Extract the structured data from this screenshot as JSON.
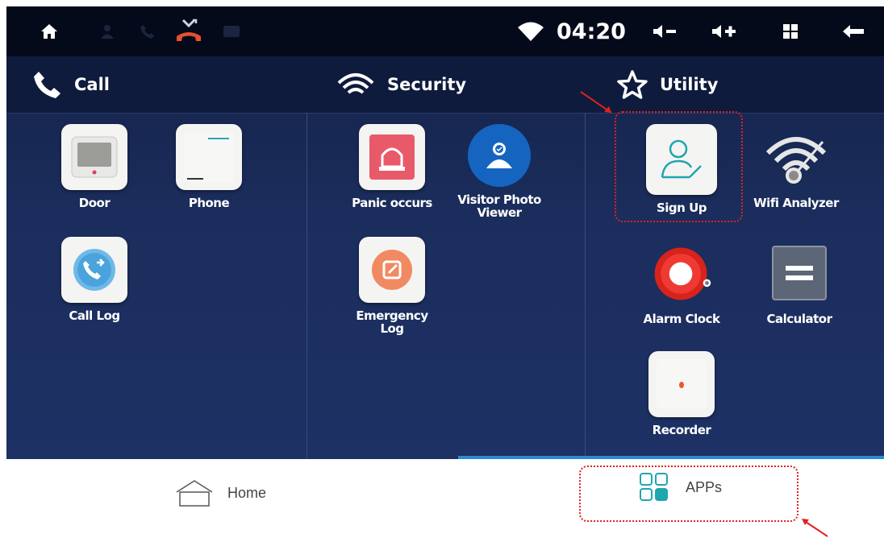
{
  "status_bar": {
    "time": "04:20",
    "icons": [
      "home-icon",
      "person-icon",
      "phone-icon",
      "missed-call-icon",
      "message-icon",
      "wifi-icon",
      "volume-down-icon",
      "volume-up-icon",
      "grid-icon",
      "back-arrow-icon"
    ]
  },
  "sections": [
    {
      "label": "Call",
      "icon": "phone-icon"
    },
    {
      "label": "Security",
      "icon": "signal-icon"
    },
    {
      "label": "Utility",
      "icon": "star-icon"
    }
  ],
  "apps": {
    "door": "Door",
    "phone": "Phone",
    "call_log": "Call Log",
    "panic_occurs": "Panic occurs",
    "visitor_photo_viewer": "Visitor Photo Viewer",
    "emergency_log": "Emergency Log",
    "sign_up": "Sign Up",
    "wifi_analyzer": "Wifi Analyzer",
    "alarm_clock": "Alarm Clock",
    "calculator": "Calculator",
    "recorder": "Recorder"
  },
  "bottom_nav": {
    "home": "Home",
    "apps": "APPs"
  },
  "colors": {
    "accent": "#1fa6b0",
    "highlight": "#e02020",
    "missed_call": "#e8502c"
  }
}
